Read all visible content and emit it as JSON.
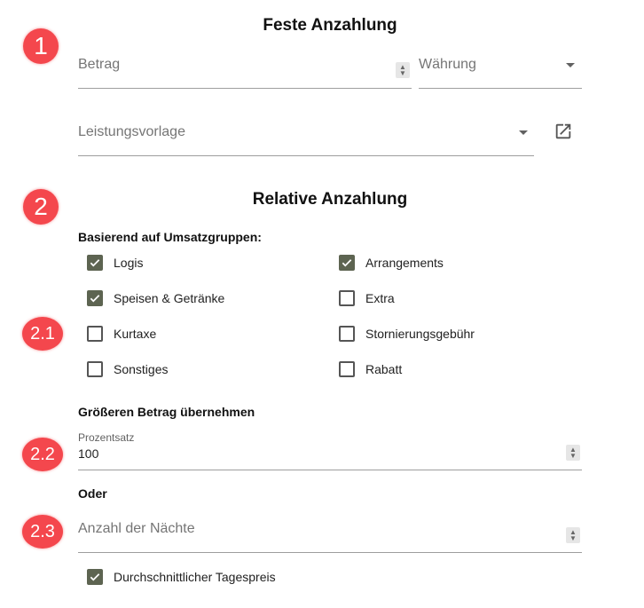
{
  "fixed": {
    "badge": "1",
    "title": "Feste Anzahlung",
    "amount_label": "Betrag",
    "currency_label": "Währung",
    "service_template_label": "Leistungsvorlage"
  },
  "relative": {
    "badge": "2",
    "title": "Relative Anzahlung",
    "revenue_groups_label": "Basierend auf Umsatzgruppen:",
    "badge_2_1": "2.1",
    "checkboxes": [
      {
        "label": "Logis",
        "checked": true
      },
      {
        "label": "Arrangements",
        "checked": true
      },
      {
        "label": "Speisen & Getränke",
        "checked": true
      },
      {
        "label": "Extra",
        "checked": false
      },
      {
        "label": "Kurtaxe",
        "checked": false
      },
      {
        "label": "Stornierungsgebühr",
        "checked": false
      },
      {
        "label": "Sonstiges",
        "checked": false
      },
      {
        "label": "Rabatt",
        "checked": false
      }
    ],
    "greater_amount_label": "Größeren Betrag übernehmen",
    "badge_2_2": "2.2",
    "percentage_label": "Prozentsatz",
    "percentage_value": "100",
    "or_label": "Oder",
    "badge_2_3": "2.3",
    "nights_label": "Anzahl der Nächte",
    "avg_daily_rate": {
      "label": "Durchschnittlicher Tagespreis",
      "checked": true
    }
  },
  "colors": {
    "badge": "#f4474d",
    "checkbox_checked": "#5d6451"
  }
}
